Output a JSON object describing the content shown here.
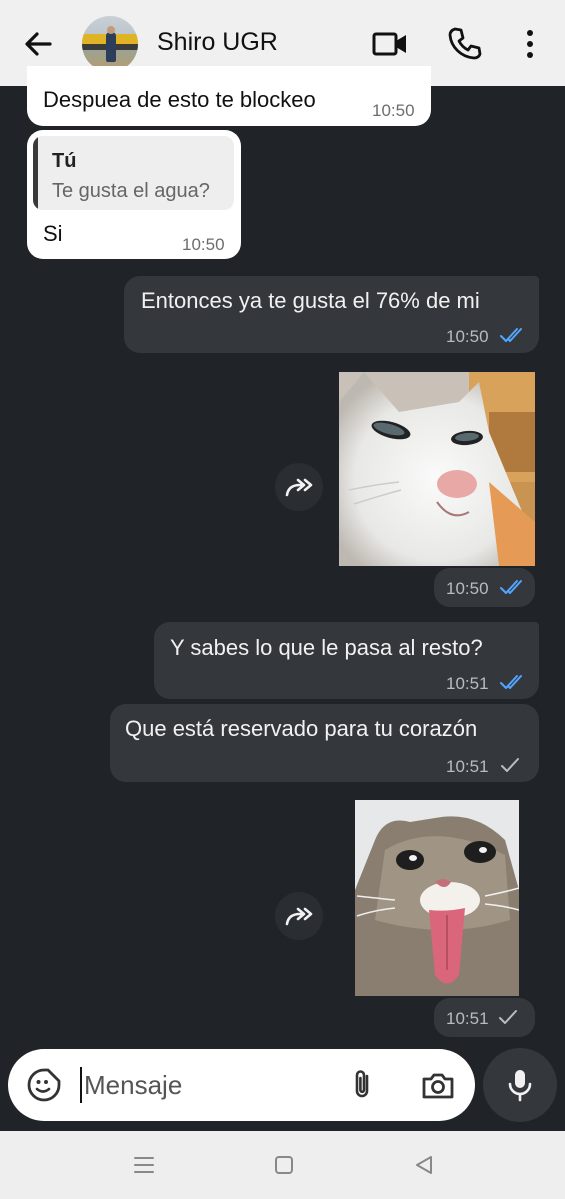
{
  "header": {
    "contact_name": "Shiro UGR",
    "icons": [
      "back-arrow-icon",
      "video-call-icon",
      "phone-icon",
      "more-vert-icon"
    ]
  },
  "messages": [
    {
      "direction": "in",
      "text": "Despuea de esto te blockeo",
      "time": "10:50"
    },
    {
      "direction": "in",
      "quote_author": "Tú",
      "quote_text": "Te gusta el agua?",
      "text": "Si",
      "time": "10:50"
    },
    {
      "direction": "out",
      "text": "Entonces ya te gusta el 76% de mi",
      "time": "10:50",
      "status": "read"
    },
    {
      "direction": "out",
      "type": "sticker",
      "sticker": "smug-white-cat",
      "time": "10:50",
      "status": "read"
    },
    {
      "direction": "out",
      "text": "Y sabes lo que le pasa al resto?",
      "time": "10:51",
      "status": "read"
    },
    {
      "direction": "out",
      "text": "Que está reservado para tu corazón",
      "time": "10:51",
      "status": "sent"
    },
    {
      "direction": "out",
      "type": "sticker",
      "sticker": "cat-tongue-out",
      "time": "10:51",
      "status": "sent"
    }
  ],
  "composer": {
    "placeholder": "Mensaje",
    "icons": [
      "emoji-sticker-icon",
      "attach-icon",
      "camera-icon",
      "mic-icon"
    ]
  },
  "colors": {
    "background": "#202429",
    "outgoing_bubble": "#34383d",
    "incoming_bubble": "#ffffff",
    "read_tick": "#53a6ff",
    "header": "#f0f0f0"
  }
}
